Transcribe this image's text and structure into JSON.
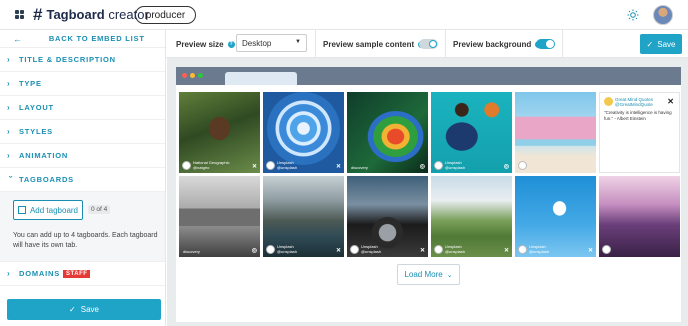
{
  "header": {
    "app_name_bold": "Tagboard",
    "app_name_rest": " creator",
    "project": "producer"
  },
  "sidebar": {
    "back_label": "BACK TO EMBED LIST",
    "items": [
      {
        "label": "TITLE & DESCRIPTION"
      },
      {
        "label": "TYPE"
      },
      {
        "label": "LAYOUT"
      },
      {
        "label": "STYLES"
      },
      {
        "label": "ANIMATION"
      },
      {
        "label": "TAGBOARDS"
      },
      {
        "label": "DOMAINS"
      }
    ],
    "staff_badge": "STAFF",
    "add_tagboard_label": "Add tagboard",
    "tagboard_count": "0 of 4",
    "help_text": "You can add up to 4 tagboards. Each tagboard will have its own tab.",
    "save_label": "Save"
  },
  "toolbar": {
    "preview_size_label": "Preview size",
    "preview_size_value": "Desktop",
    "sample_content_label": "Preview sample content",
    "sample_content_on": false,
    "background_label": "Preview background",
    "background_on": true,
    "save_label": "Save"
  },
  "colors": {
    "accent": "#1fa3c7",
    "link": "#1b8fb3",
    "staff": "#e53935",
    "browser_chrome": "#6b7a8f"
  },
  "preview": {
    "tiles": [
      {
        "kind": "photo",
        "subject": "orangutan",
        "source": "National Geographic\n@natgeo",
        "network": "twitter"
      },
      {
        "kind": "photo",
        "subject": "blue-arches",
        "source": "Unsplash\n@unsplash",
        "network": "twitter"
      },
      {
        "kind": "photo",
        "subject": "parrot",
        "source": "discovery",
        "network": "instagram"
      },
      {
        "kind": "photo",
        "subject": "basketball",
        "source": "Unsplash\n@unsplash",
        "network": "instagram"
      },
      {
        "kind": "photo",
        "subject": "lifeguard-tower",
        "source": "",
        "network": ""
      },
      {
        "kind": "quote",
        "name": "Great Mind Quotes\n@GreatMindQuote",
        "text": "\"Creativity is intelligence is having fun.\" - Albert Einstein",
        "network": "twitter"
      },
      {
        "kind": "photo",
        "subject": "pyramid",
        "source": "discovery",
        "network": "instagram"
      },
      {
        "kind": "photo",
        "subject": "mountain-lake",
        "source": "Unsplash\n@unsplash",
        "network": "twitter"
      },
      {
        "kind": "photo",
        "subject": "car",
        "source": "Unsplash\n@unsplash",
        "network": "twitter"
      },
      {
        "kind": "photo",
        "subject": "valley",
        "source": "Unsplash\n@unsplash",
        "network": "twitter"
      },
      {
        "kind": "photo",
        "subject": "snowboarder",
        "source": "Unsplash\n@unsplash",
        "network": "twitter"
      },
      {
        "kind": "photo",
        "subject": "purple-mountains",
        "source": "",
        "network": ""
      }
    ],
    "load_more_label": "Load More"
  }
}
